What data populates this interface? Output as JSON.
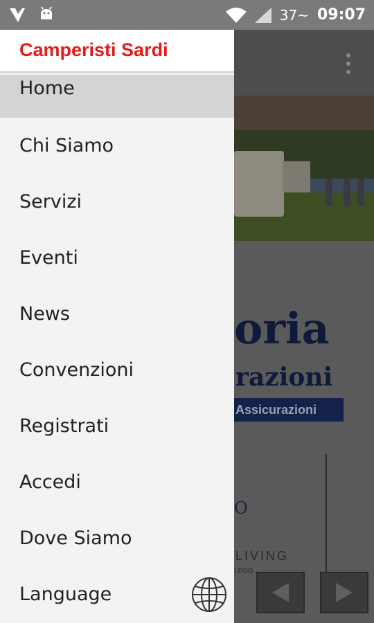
{
  "statusbar": {
    "left_icons": [
      "notification-icon",
      "android-icon"
    ],
    "wifi_icon": "wifi-icon",
    "signal_icon": "signal-icon",
    "temperature": "37~",
    "time": "09:07"
  },
  "drawer": {
    "title": "Camperisti Sardi",
    "items": [
      {
        "label": "Home",
        "active": true
      },
      {
        "label": "Chi Siamo"
      },
      {
        "label": "Servizi"
      },
      {
        "label": "Eventi"
      },
      {
        "label": "News"
      },
      {
        "label": "Convenzioni"
      },
      {
        "label": "Registrati"
      },
      {
        "label": "Accedi"
      },
      {
        "label": "Dove Siamo"
      },
      {
        "label": "Language",
        "icon": "globe-icon"
      }
    ]
  },
  "background": {
    "banner_big": "oria",
    "banner_sub": "razioni",
    "banner_pill": "Assicurazioni",
    "promo_o": "O",
    "promo_living": "LIVING",
    "promo_small": "LEGG",
    "prev_icon": "arrow-left-icon",
    "next_icon": "arrow-right-icon"
  },
  "colors": {
    "brand": "#e31b1b",
    "statusbar": "#7a7a7a",
    "drawer_bg": "#f3f3f3",
    "active_item": "#d4d4d4"
  }
}
